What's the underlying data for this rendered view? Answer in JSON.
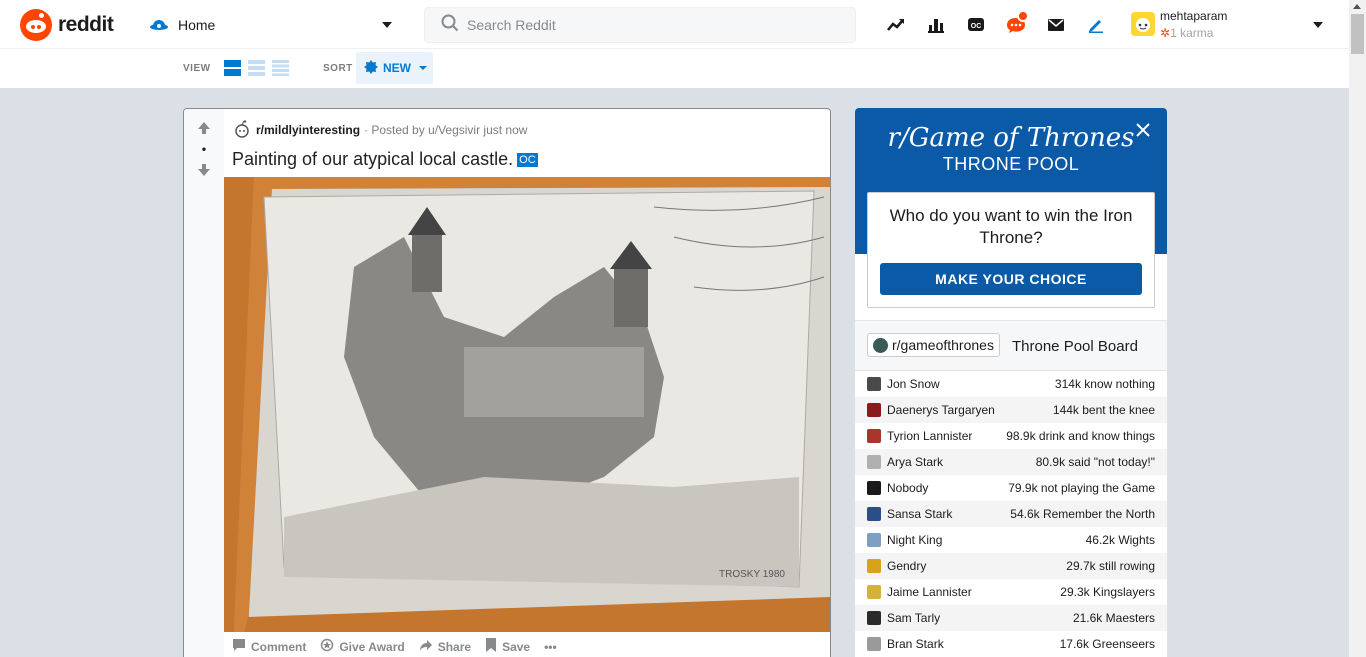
{
  "header": {
    "logo_text": "reddit",
    "home_label": "Home",
    "search_placeholder": "Search Reddit",
    "username": "mehtaparam",
    "karma": "1 karma",
    "icons": [
      "trending-icon",
      "stats-icon",
      "chat-oc-icon",
      "chat-icon",
      "mail-icon",
      "pencil-icon"
    ]
  },
  "subbar": {
    "view_label": "VIEW",
    "sort_label": "SORT",
    "sort_value": "NEW"
  },
  "post": {
    "score": "•",
    "subreddit": "r/mildlyinteresting",
    "posted_by": "· Posted by u/Vegsivir just now",
    "title": "Painting of our atypical local castle.",
    "flair": "OC",
    "actions": {
      "comment": "Comment",
      "award": "Give Award",
      "share": "Share",
      "save": "Save",
      "more": "•••"
    },
    "image_signature": "TROSKY 1980"
  },
  "sidebar": {
    "promo_title": "r/Game of Thrones",
    "promo_subtitle": "THRONE POOL",
    "question": "Who do you want to win the Iron Throne?",
    "cta_label": "MAKE YOUR CHOICE",
    "board_sub": "r/gameofthrones",
    "board_title": "Throne Pool Board",
    "rows": [
      {
        "name": "Jon Snow",
        "count": "314k know nothing",
        "color": "#4a4a4a"
      },
      {
        "name": "Daenerys Targaryen",
        "count": "144k bent the knee",
        "color": "#8b1a1a"
      },
      {
        "name": "Tyrion Lannister",
        "count": "98.9k drink and know things",
        "color": "#a8362a"
      },
      {
        "name": "Arya Stark",
        "count": "80.9k said \"not today!\"",
        "color": "#b0b0b0"
      },
      {
        "name": "Nobody",
        "count": "79.9k not playing the Game",
        "color": "#1a1a1a"
      },
      {
        "name": "Sansa Stark",
        "count": "54.6k Remember the North",
        "color": "#2a4e8a"
      },
      {
        "name": "Night King",
        "count": "46.2k Wights",
        "color": "#7d9fc4"
      },
      {
        "name": "Gendry",
        "count": "29.7k still rowing",
        "color": "#d8a21a"
      },
      {
        "name": "Jaime Lannister",
        "count": "29.3k Kingslayers",
        "color": "#d4b23a"
      },
      {
        "name": "Sam Tarly",
        "count": "21.6k Maesters",
        "color": "#2a2a2a"
      },
      {
        "name": "Bran Stark",
        "count": "17.6k Greenseers",
        "color": "#9a9a9a"
      }
    ]
  },
  "colors": {
    "accent": "#0079d3",
    "brand": "#ff4500",
    "got_blue": "#0a5aa8"
  }
}
